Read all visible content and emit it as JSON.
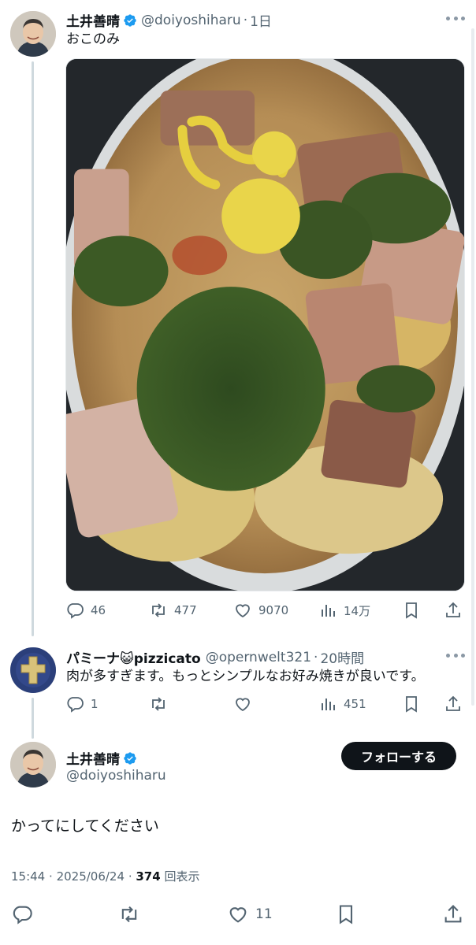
{
  "tweet": {
    "author_name": "土井善晴",
    "handle": "@doiyoshiharu",
    "time": "1日",
    "text": "おこのみ",
    "stats": {
      "replies": "46",
      "retweets": "477",
      "likes": "9070",
      "views": "14万"
    }
  },
  "reply": {
    "author_name": "パミーナ😺pizzicato",
    "handle": "@opernwelt321",
    "time": "20時間",
    "text": "肉が多すぎます。もっとシンプルなお好み焼きが良いです。",
    "stats": {
      "replies": "1",
      "retweets": "",
      "likes": "",
      "views": "451"
    }
  },
  "main_tweet": {
    "author_name": "土井善晴",
    "handle": "@doiyoshiharu",
    "follow_label": "フォローする",
    "text": "かってにしてください",
    "time": "15:44",
    "date": "2025/06/24",
    "view_count": "374",
    "view_suffix": "回表示",
    "likes": "11"
  },
  "colors": {
    "verified": "#1d9bf0",
    "follow_bg": "#0f1419",
    "muted": "#536471"
  },
  "icons": [
    "more-icon",
    "reply-icon",
    "retweet-icon",
    "like-icon",
    "views-icon",
    "bookmark-icon",
    "share-icon",
    "verified-icon"
  ]
}
